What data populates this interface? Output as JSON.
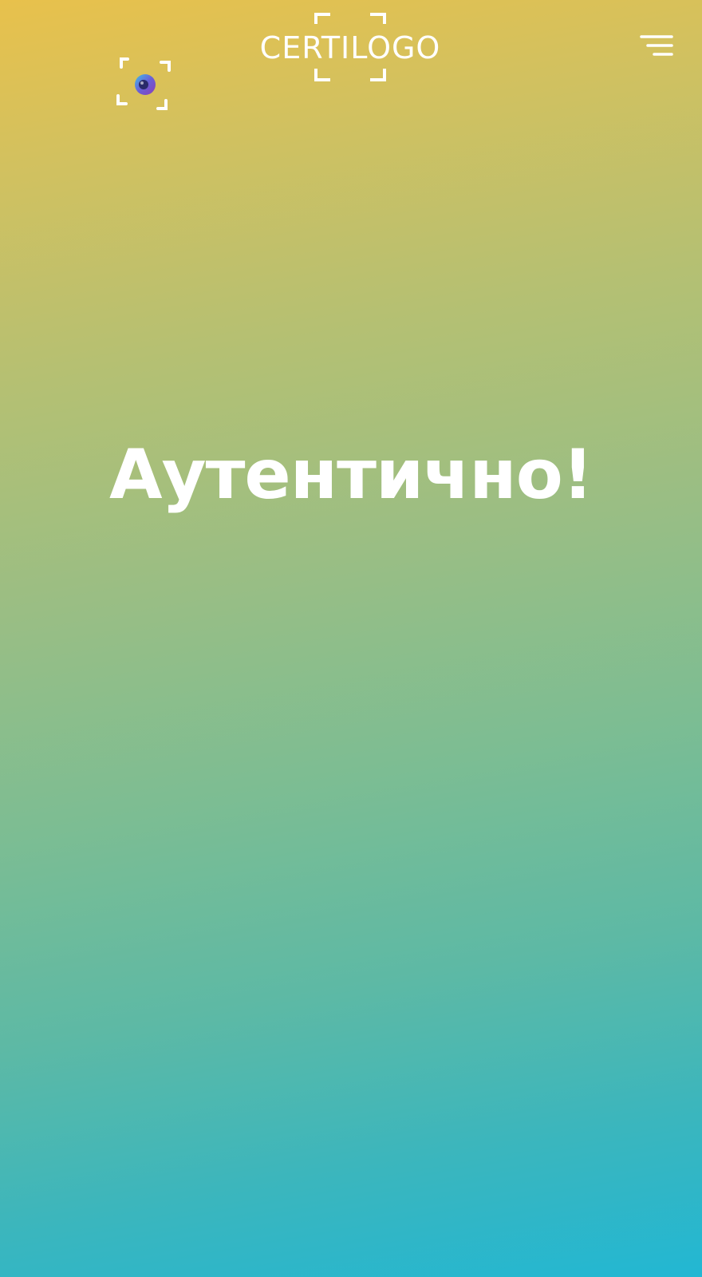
{
  "header": {
    "logo_text": "CERTILOGO",
    "scan_icon": "camera-scan-icon",
    "menu_icon": "hamburger-menu-icon"
  },
  "result": {
    "headline": "Аутентично!"
  },
  "colors": {
    "gradient_top": "#e8c14c",
    "gradient_bottom": "#22b7d3",
    "text": "#ffffff"
  }
}
